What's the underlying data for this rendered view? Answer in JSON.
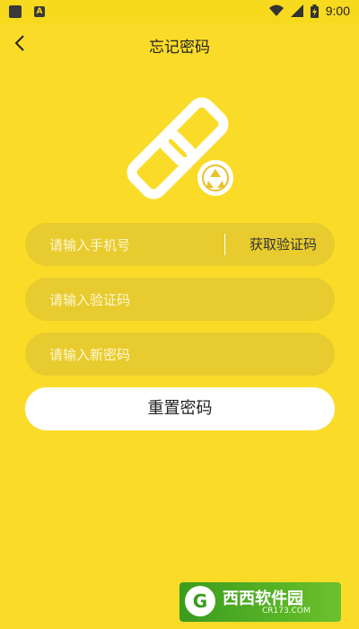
{
  "status_bar": {
    "time": "9:00",
    "notif_icon": "A"
  },
  "header": {
    "title": "忘记密码"
  },
  "form": {
    "phone_placeholder": "请输入手机号",
    "get_code_label": "获取验证码",
    "code_placeholder": "请输入验证码",
    "new_password_placeholder": "请输入新密码",
    "reset_button_label": "重置密码"
  },
  "watermark": {
    "logo": "G",
    "name": "西西软件园",
    "url": "CR173.COM"
  },
  "colors": {
    "background": "#FADC28",
    "field": "#E8CB2E",
    "button": "#FFFFFF"
  }
}
